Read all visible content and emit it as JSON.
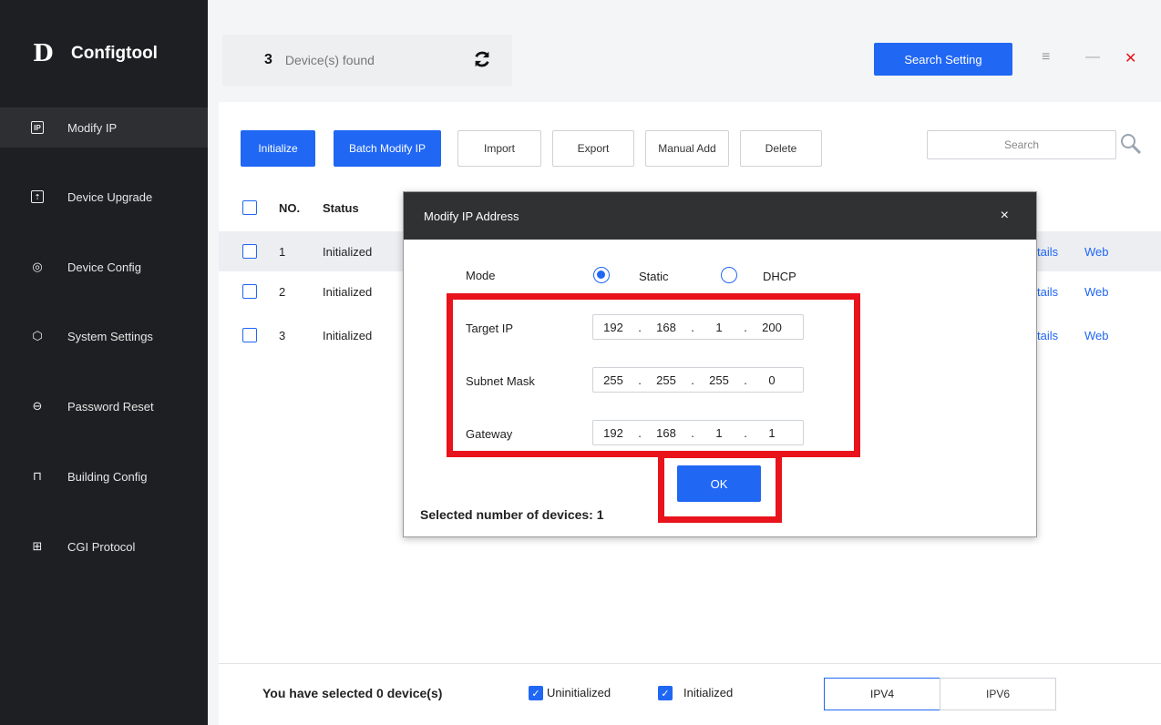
{
  "app": {
    "name": "Configtool",
    "logo_glyph": "D"
  },
  "sidebar": {
    "items": [
      {
        "label": "Modify IP",
        "icon": "ip-icon",
        "glyph": "IP",
        "active": true
      },
      {
        "label": "Device Upgrade",
        "icon": "upload-icon",
        "glyph": "⇡"
      },
      {
        "label": "Device Config",
        "icon": "target-icon",
        "glyph": "◎"
      },
      {
        "label": "System Settings",
        "icon": "hex-settings-icon",
        "glyph": "⬡"
      },
      {
        "label": "Password Reset",
        "icon": "lock-icon",
        "glyph": "⊖"
      },
      {
        "label": "Building Config",
        "icon": "building-icon",
        "glyph": "⊓"
      },
      {
        "label": "CGI Protocol",
        "icon": "grid-icon",
        "glyph": "⊞"
      }
    ]
  },
  "topbar": {
    "device_count": "3",
    "device_count_label": "Device(s) found",
    "search_setting_label": "Search Setting",
    "menu_glyph": "≡",
    "minimize_glyph": "—",
    "close_glyph": "✕"
  },
  "toolbar": {
    "initialize": "Initialize",
    "batch_modify_ip": "Batch Modify IP",
    "import": "Import",
    "export": "Export",
    "manual_add": "Manual Add",
    "delete": "Delete",
    "search_placeholder": "Search"
  },
  "table": {
    "headers": {
      "no": "NO.",
      "status": "Status"
    },
    "rows": [
      {
        "no": "1",
        "status": "Initialized",
        "details": "tails",
        "web": "Web",
        "selected": true
      },
      {
        "no": "2",
        "status": "Initialized",
        "details": "tails",
        "web": "Web"
      },
      {
        "no": "3",
        "status": "Initialized",
        "details": "tails",
        "web": "Web"
      }
    ]
  },
  "modal": {
    "title": "Modify IP Address",
    "close_glyph": "×",
    "mode_label": "Mode",
    "static_label": "Static",
    "dhcp_label": "DHCP",
    "target_ip_label": "Target IP",
    "target_ip": [
      "192",
      "168",
      "1",
      "200"
    ],
    "subnet_label": "Subnet Mask",
    "subnet": [
      "255",
      "255",
      "255",
      "0"
    ],
    "gateway_label": "Gateway",
    "gateway": [
      "192",
      "168",
      "1",
      "1"
    ],
    "ok_label": "OK",
    "selected_text": "Selected number of devices: 1"
  },
  "footer": {
    "selected_text": "You have selected 0  device(s)",
    "uninitialized_label": "Uninitialized",
    "initialized_label": "Initialized",
    "check_glyph": "✓",
    "ipv4": "IPV4",
    "ipv6": "IPV6"
  },
  "colors": {
    "accent": "#2067f4",
    "sidebar": "#1e1f22",
    "highlight": "#e8131b"
  }
}
